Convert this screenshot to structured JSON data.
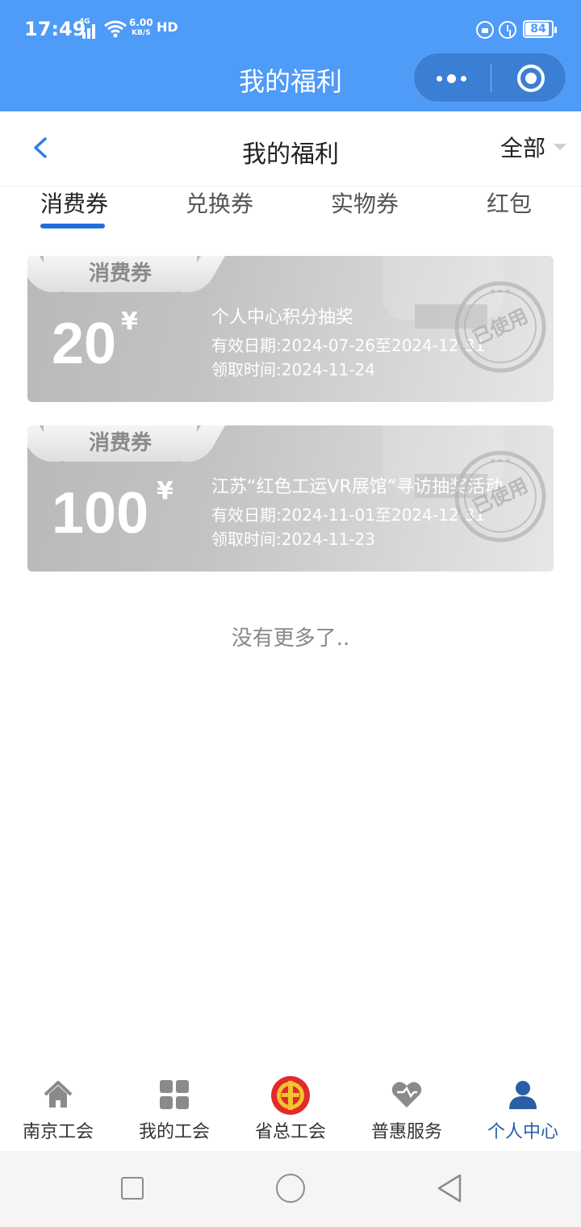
{
  "status_bar": {
    "time": "17:49",
    "network": "4G",
    "speed_value": "6.00",
    "speed_unit": "KB/S",
    "hd": "HD",
    "battery": "84"
  },
  "app_bar": {
    "title": "我的福利"
  },
  "header": {
    "title": "我的福利",
    "filter_label": "全部"
  },
  "tabs": [
    {
      "label": "消费券",
      "active": true
    },
    {
      "label": "兑换券",
      "active": false
    },
    {
      "label": "实物券",
      "active": false
    },
    {
      "label": "红包",
      "active": false
    }
  ],
  "coupons": [
    {
      "type_tag": "消费券",
      "amount": "20",
      "currency": "¥",
      "name": "个人中心积分抽奖",
      "valid_label": "有效日期:",
      "valid_range": "2024-07-26至2024-12-31",
      "claim_label": "领取时间:",
      "claim_date": "2024-11-24",
      "status_stamp": "已使用"
    },
    {
      "type_tag": "消费券",
      "amount": "100",
      "currency": "¥",
      "name": "江苏“红色工运VR展馆”寻访抽奖活动",
      "valid_label": "有效日期:",
      "valid_range": "2024-11-01至2024-12-31",
      "claim_label": "领取时间:",
      "claim_date": "2024-11-23",
      "status_stamp": "已使用"
    }
  ],
  "list_end_text": "没有更多了..",
  "bottom_nav": [
    {
      "label": "南京工会",
      "icon": "home-icon",
      "active": false
    },
    {
      "label": "我的工会",
      "icon": "grid-icon",
      "active": false
    },
    {
      "label": "省总工会",
      "icon": "union-emblem-icon",
      "active": false
    },
    {
      "label": "普惠服务",
      "icon": "heart-icon",
      "active": false
    },
    {
      "label": "个人中心",
      "icon": "person-icon",
      "active": true
    }
  ],
  "colors": {
    "topbar": "#4e9bf8",
    "tab_underline": "#1f6fd6",
    "nav_active": "#2a5ea7"
  }
}
